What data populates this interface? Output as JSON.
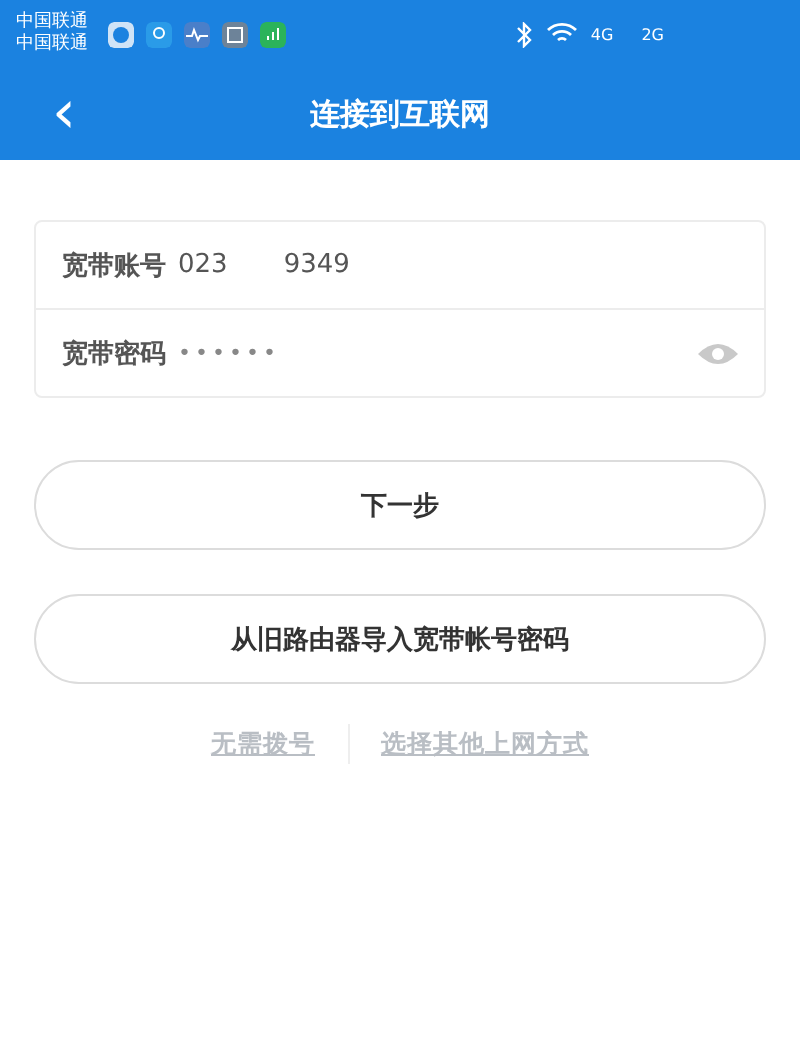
{
  "status_bar": {
    "carriers": [
      "中国联通",
      "中国联通"
    ],
    "networks": [
      "4G",
      "2G"
    ]
  },
  "header": {
    "back": "‹",
    "title": "连接到互联网"
  },
  "form": {
    "fields": [
      {
        "kind": "text",
        "label": "宽带账号",
        "value_start": "023",
        "value_end": "9349"
      },
      {
        "kind": "password",
        "label": "宽带密码",
        "value": "••••••"
      }
    ]
  },
  "buttons": [
    "下一步",
    "从旧路由器导入宽带帐号密码"
  ],
  "links": [
    "无需拨号",
    "选择其他上网方式"
  ]
}
